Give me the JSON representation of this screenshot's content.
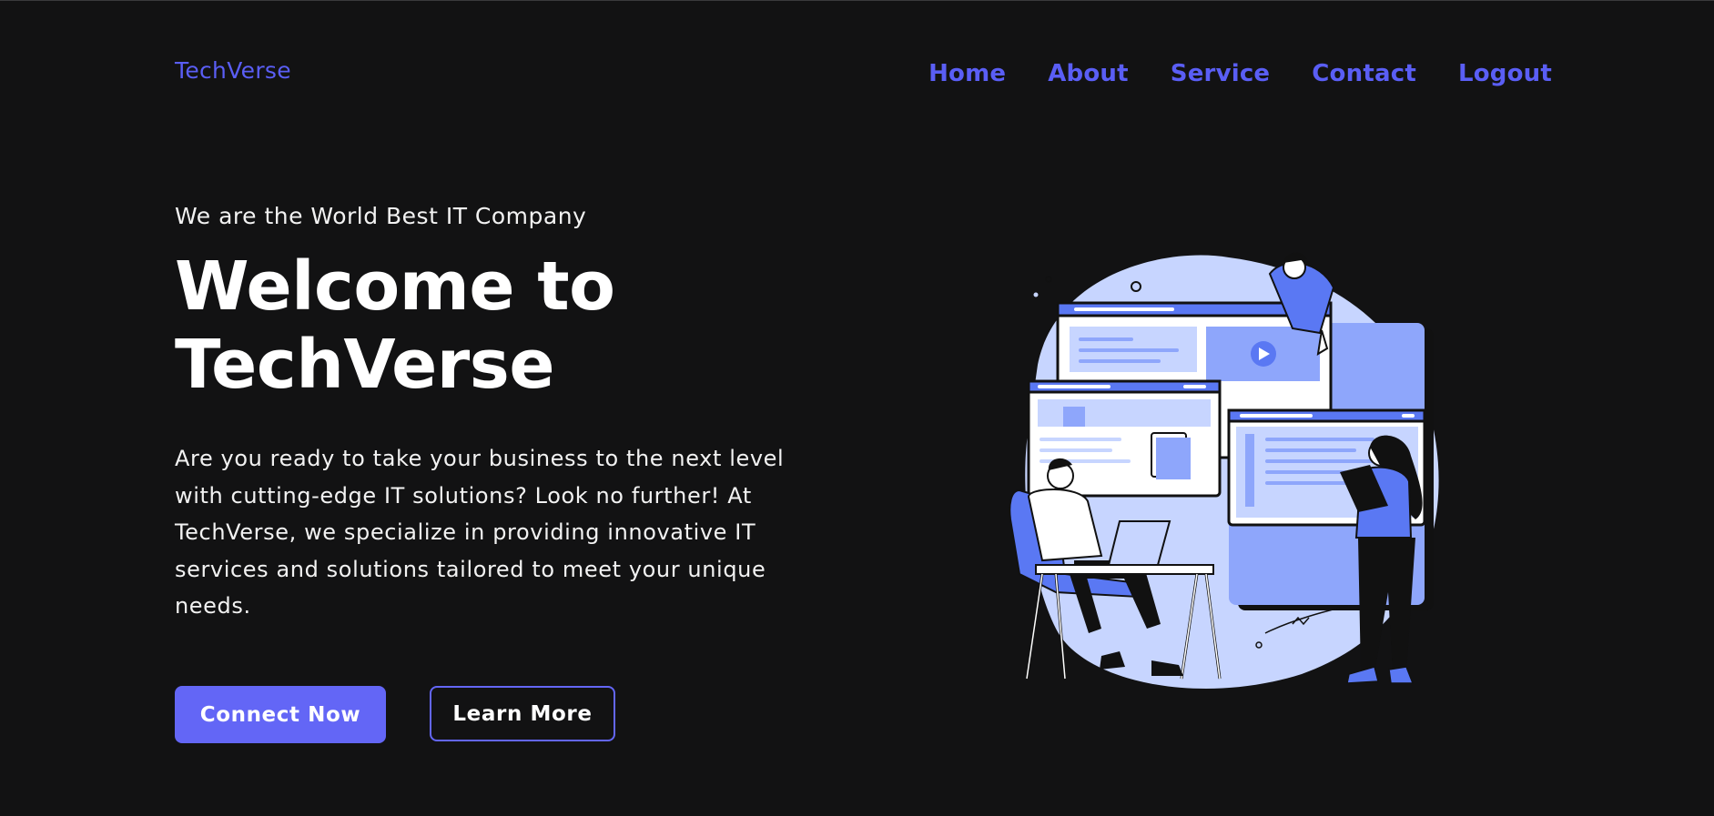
{
  "brand": "TechVerse",
  "nav": {
    "home": "Home",
    "about": "About",
    "service": "Service",
    "contact": "Contact",
    "logout": "Logout"
  },
  "hero": {
    "tagline": "We are the World Best IT Company",
    "headline_line1": "Welcome to",
    "headline_line2": "TechVerse",
    "description": "Are you ready to take your business to the next level with cutting-edge IT solutions? Look no further! At TechVerse, we specialize in providing innovative IT services and solutions tailored to meet your unique needs.",
    "primary_button": "Connect Now",
    "secondary_button": "Learn More",
    "illustration_icon": "it-team-illustration"
  },
  "colors": {
    "background": "#121213",
    "accent": "#6366f6",
    "nav_link": "#5a5ef5",
    "illustration_light": "#c7d5ff",
    "illustration_mid": "#8ea6fb",
    "illustration_dark": "#5a78f3"
  }
}
